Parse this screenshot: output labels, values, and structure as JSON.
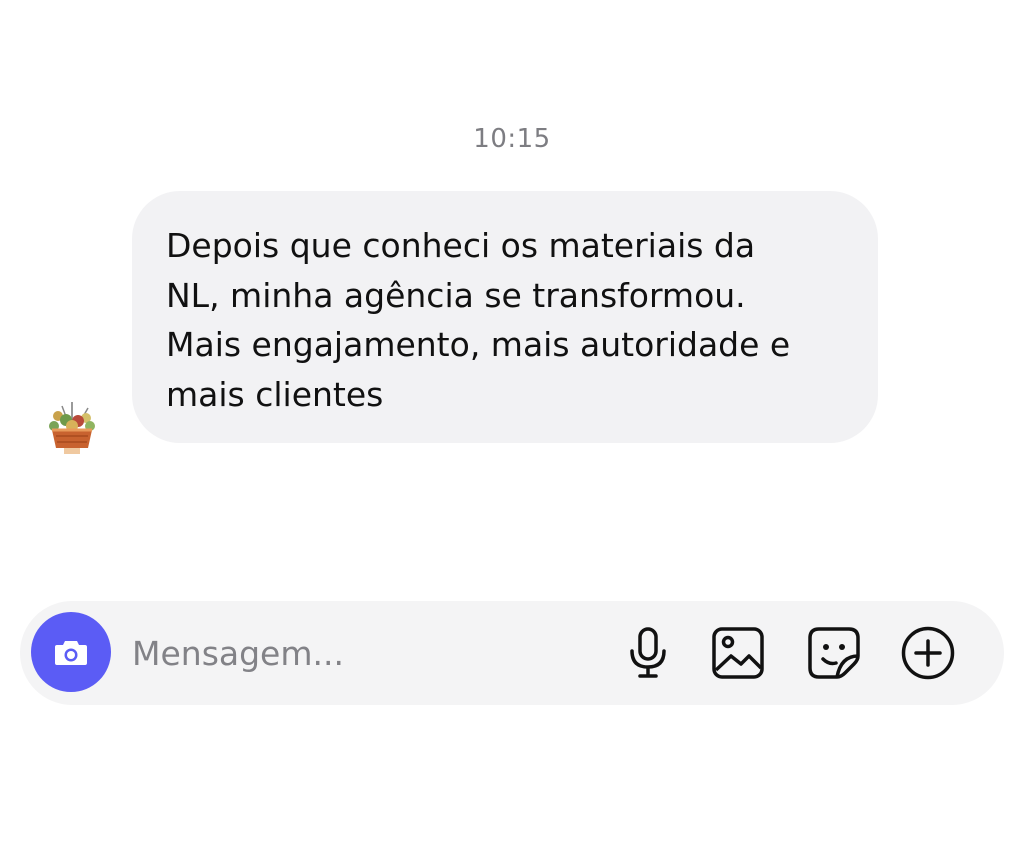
{
  "chat": {
    "timestamp": "10:15",
    "message_lines": [
      "Depois que conheci os materiais da",
      "NL, minha agência se transformou.",
      "Mais engajamento, mais autoridade e",
      "mais clientes"
    ]
  },
  "composer": {
    "placeholder": "Mensagem...",
    "value": "",
    "camera_icon": "camera-icon",
    "tools": [
      "microphone-icon",
      "gallery-icon",
      "sticker-icon",
      "plus-circle-icon"
    ]
  },
  "colors": {
    "accent": "#5b5cf5",
    "bubble": "#f2f2f4",
    "composer": "#f4f4f5",
    "timestamp": "#7d7d82"
  }
}
